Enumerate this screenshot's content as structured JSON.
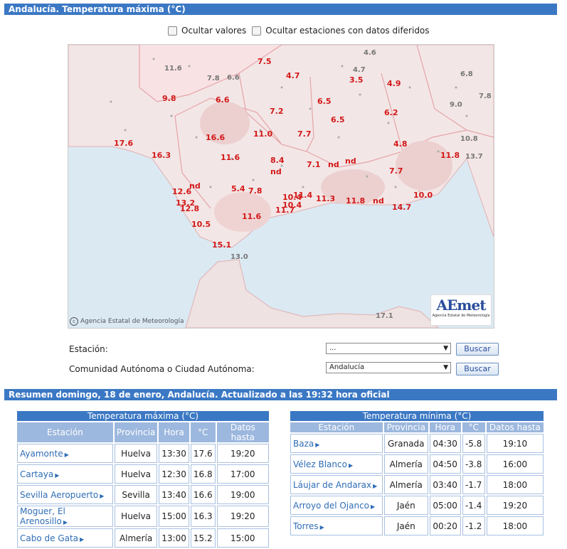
{
  "header": {
    "title": "Andalucía. Temperatura máxima (°C)"
  },
  "options": {
    "hide_values": "Ocultar valores",
    "hide_deferred": "Ocultar estaciones con datos diferidos"
  },
  "map": {
    "credit": "Agencia Estatal de Meteorología",
    "logo_text": "AEmet",
    "logo_sub": "Agencia Estatal de Meteorología",
    "values": [
      {
        "v": "7.5",
        "g": false
      },
      {
        "v": "4.7",
        "g": false
      },
      {
        "v": "3.5",
        "g": false
      },
      {
        "v": "4.9",
        "g": false
      },
      {
        "v": "9.8",
        "g": false
      },
      {
        "v": "6.6",
        "g": false
      },
      {
        "v": "6.5",
        "g": false
      },
      {
        "v": "7.2",
        "g": false
      },
      {
        "v": "6.2",
        "g": false
      },
      {
        "v": "6.5",
        "g": false
      },
      {
        "v": "16.6",
        "g": false
      },
      {
        "v": "11.0",
        "g": false
      },
      {
        "v": "7.7",
        "g": false
      },
      {
        "v": "17.6",
        "g": false
      },
      {
        "v": "4.8",
        "g": false
      },
      {
        "v": "16.3",
        "g": false
      },
      {
        "v": "11.6",
        "g": false
      },
      {
        "v": "8.4",
        "g": false
      },
      {
        "v": "7.1",
        "g": false
      },
      {
        "v": "nd",
        "g": false
      },
      {
        "v": "nd",
        "g": false
      },
      {
        "v": "11.8",
        "g": false
      },
      {
        "v": "nd",
        "g": false
      },
      {
        "v": "7.7",
        "g": false
      },
      {
        "v": "nd",
        "g": false
      },
      {
        "v": "12.6",
        "g": false
      },
      {
        "v": "5.4",
        "g": false
      },
      {
        "v": "7.8",
        "g": false
      },
      {
        "v": "10.4",
        "g": false
      },
      {
        "v": "11.4",
        "g": false
      },
      {
        "v": "10.0",
        "g": false
      },
      {
        "v": "13.2",
        "g": false
      },
      {
        "v": "12.8",
        "g": false
      },
      {
        "v": "10.4",
        "g": false
      },
      {
        "v": "11.3",
        "g": false
      },
      {
        "v": "11.8",
        "g": false
      },
      {
        "v": "nd",
        "g": false
      },
      {
        "v": "14.7",
        "g": false
      },
      {
        "v": "11.7",
        "g": false
      },
      {
        "v": "11.6",
        "g": false
      },
      {
        "v": "10.5",
        "g": false
      },
      {
        "v": "15.1",
        "g": false
      },
      {
        "v": "4.6",
        "g": true
      },
      {
        "v": "11.6",
        "g": true
      },
      {
        "v": "7.8",
        "g": true
      },
      {
        "v": "6.6",
        "g": true
      },
      {
        "v": "4.7",
        "g": true
      },
      {
        "v": "6.8",
        "g": true
      },
      {
        "v": "7.8",
        "g": true
      },
      {
        "v": "9.0",
        "g": true
      },
      {
        "v": "10.8",
        "g": true
      },
      {
        "v": "13.7",
        "g": true
      },
      {
        "v": "13.0",
        "g": true
      },
      {
        "v": "17.1",
        "g": true
      }
    ]
  },
  "form": {
    "station_label": "Estación:",
    "station_value": "...",
    "community_label": "Comunidad Autónoma o Ciudad Autónoma:",
    "community_value": "Andalucía",
    "search_label": "Buscar"
  },
  "summary": {
    "title": "Resumen domingo, 18 de enero, Andalucía. Actualizado a las 19:32 hora oficial"
  },
  "max_table": {
    "title": "Temperatura máxima (°C)",
    "headers": [
      "Estación",
      "Provincia",
      "Hora",
      "°C",
      "Datos hasta"
    ],
    "rows": [
      [
        "Ayamonte",
        "Huelva",
        "13:30",
        "17.6",
        "19:20"
      ],
      [
        "Cartaya",
        "Huelva",
        "12:30",
        "16.8",
        "17:00"
      ],
      [
        "Sevilla Aeropuerto",
        "Sevilla",
        "13:40",
        "16.6",
        "19:00"
      ],
      [
        "Moguer, El Arenosillo",
        "Huelva",
        "15:00",
        "16.3",
        "19:20"
      ],
      [
        "Cabo de Gata",
        "Almería",
        "13:00",
        "15.2",
        "15:00"
      ]
    ]
  },
  "min_table": {
    "title": "Temperatura mínima (°C)",
    "headers": [
      "Estación",
      "Provincia",
      "Hora",
      "°C",
      "Datos hasta"
    ],
    "rows": [
      [
        "Baza",
        "Granada",
        "04:30",
        "-5.8",
        "19:10"
      ],
      [
        "Vélez Blanco",
        "Almería",
        "04:50",
        "-3.8",
        "16:00"
      ],
      [
        "Láujar de Andarax",
        "Almería",
        "03:40",
        "-1.7",
        "18:00"
      ],
      [
        "Arroyo del Ojanco",
        "Jaén",
        "05:00",
        "-1.4",
        "19:20"
      ],
      [
        "Torres",
        "Jaén",
        "00:20",
        "-1.2",
        "18:00"
      ]
    ]
  }
}
